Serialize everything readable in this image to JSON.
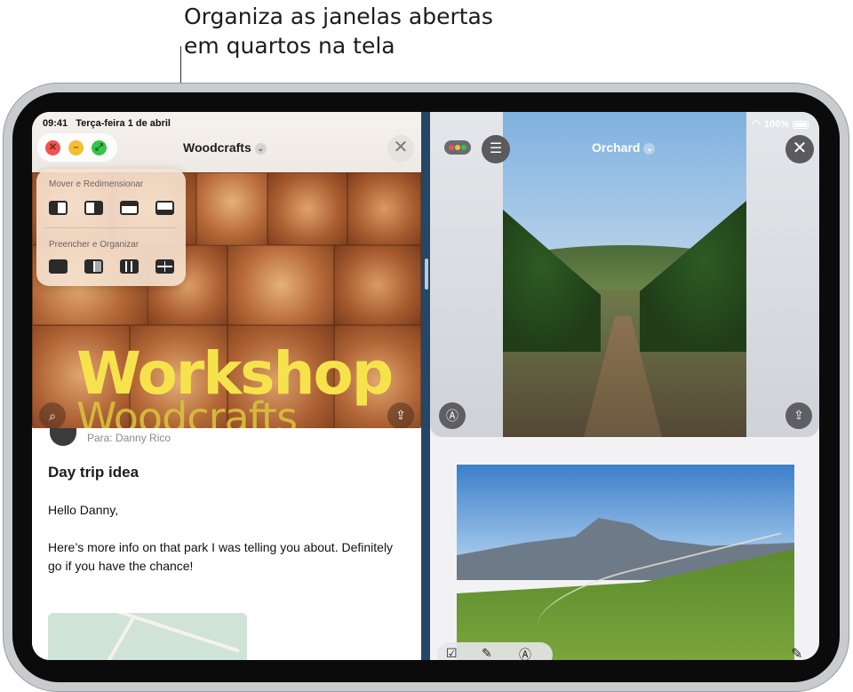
{
  "callout": {
    "line1": "Organiza as janelas abertas",
    "line2": "em quartos na tela"
  },
  "status_bar": {
    "time": "09:41",
    "date": "Terça-feira 1 de abril",
    "battery": "100%"
  },
  "left_window": {
    "title": "Woodcrafts",
    "poster_title": "Workshop",
    "poster_subtitle": "Woodcrafts",
    "menu": {
      "section1": "Mover e Redimensionar",
      "section2": "Preencher e Organizar"
    },
    "mail": {
      "to_prefix": "Para:",
      "to_name": "Danny Rico",
      "subject": "Day trip idea",
      "greeting": "Hello Danny,",
      "body": "Here’s more info on that park I was telling you about. Definitely go if you have the chance!"
    }
  },
  "right_window": {
    "title": "Orchard"
  },
  "icons": {
    "close": "✕",
    "minimize": "–",
    "chevron": "⌄",
    "search": "⌕",
    "share": "⇪",
    "list": "☰",
    "markup": "Ⓐ",
    "trash": "🗑",
    "folder": "▭",
    "reply": "↶",
    "checklist": "☑",
    "pen": "✎",
    "compose": "✎"
  },
  "colors": {
    "accent_red": "#f0524f",
    "accent_yellow": "#f5bd2f",
    "accent_green": "#36c44a",
    "poster_yellow": "#f6e34c"
  }
}
